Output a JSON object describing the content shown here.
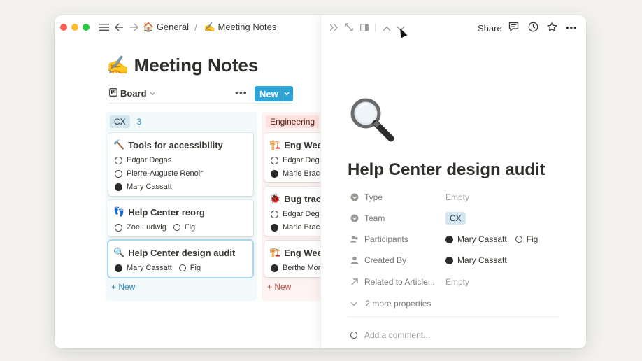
{
  "breadcrumb": {
    "home_emoji": "🏠",
    "home": "General",
    "separator": "/",
    "page_emoji": "✍️",
    "page": "Meeting Notes"
  },
  "page": {
    "emoji": "✍️",
    "title": "Meeting Notes"
  },
  "view": {
    "tab_label": "Board",
    "more": "•••",
    "new_label": "New"
  },
  "columns": {
    "cx": {
      "tag": "CX",
      "count": "3",
      "new_label": "+ New",
      "cards": [
        {
          "emoji": "🔨",
          "title": "Tools for accessibility",
          "people": [
            "Edgar Degas",
            "Pierre-Auguste Renoir",
            "Mary Cassatt"
          ]
        },
        {
          "emoji": "👣",
          "title": "Help Center reorg",
          "people": [
            "Zoe Ludwig",
            "Fig"
          ]
        },
        {
          "emoji": "🔍",
          "title": "Help Center design audit",
          "people": [
            "Mary Cassatt",
            "Fig"
          ]
        }
      ]
    },
    "eng": {
      "tag": "Engineering",
      "new_label": "+ New",
      "cards": [
        {
          "emoji": "🏗️",
          "title": "Eng Weekl",
          "people": [
            "Edgar Dega",
            "Marie Bracq"
          ]
        },
        {
          "emoji": "🐞",
          "title": "Bug trackin",
          "people": [
            "Edgar Dega",
            "Marie Bracq"
          ]
        },
        {
          "emoji": "🏗️",
          "title": "Eng Weekl",
          "people": [
            "Berthe Mori"
          ]
        }
      ]
    }
  },
  "detail": {
    "share_label": "Share",
    "more": "•••",
    "icon_emoji": "🔍",
    "title": "Help Center design audit",
    "properties": {
      "type": {
        "label": "Type",
        "value": "Empty"
      },
      "team": {
        "label": "Team",
        "value": "CX"
      },
      "participants": {
        "label": "Participants",
        "people": [
          "Mary Cassatt",
          "Fig"
        ]
      },
      "created_by": {
        "label": "Created By",
        "value": "Mary Cassatt"
      },
      "related": {
        "label": "Related to Article...",
        "value": "Empty"
      }
    },
    "more_properties": "2 more properties",
    "comment_placeholder": "Add a comment..."
  },
  "colors": {
    "accent_blue": "#2ea3d5",
    "cx_tag_bg": "#d3e5ef",
    "eng_tag_bg": "#ffe2dd"
  }
}
